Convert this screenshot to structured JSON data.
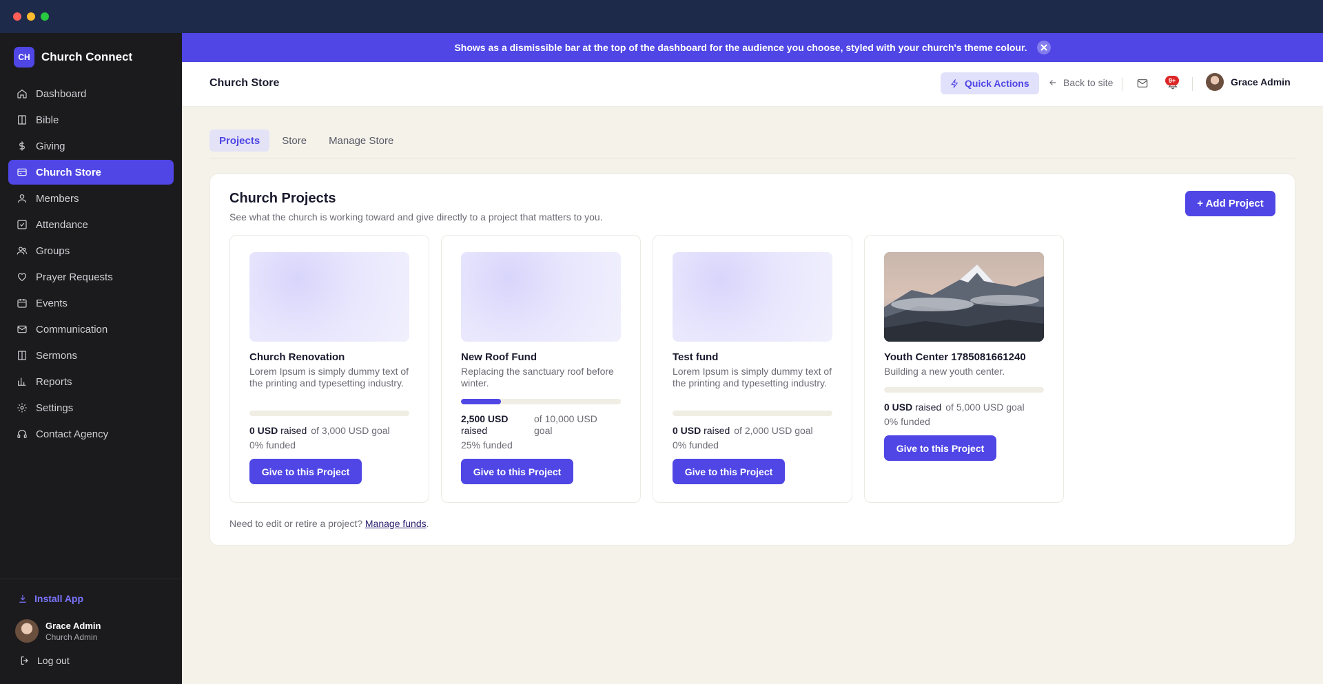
{
  "app": {
    "logo_text": "CH",
    "name": "Church Connect"
  },
  "sidebar": {
    "items": [
      {
        "label": "Dashboard",
        "icon": "home-icon",
        "active": false
      },
      {
        "label": "Bible",
        "icon": "book-icon",
        "active": false
      },
      {
        "label": "Giving",
        "icon": "dollar-icon",
        "active": false
      },
      {
        "label": "Church Store",
        "icon": "card-icon",
        "active": true
      },
      {
        "label": "Members",
        "icon": "user-icon",
        "active": false
      },
      {
        "label": "Attendance",
        "icon": "check-square-icon",
        "active": false
      },
      {
        "label": "Groups",
        "icon": "users-icon",
        "active": false
      },
      {
        "label": "Prayer Requests",
        "icon": "heart-icon",
        "active": false
      },
      {
        "label": "Events",
        "icon": "calendar-icon",
        "active": false
      },
      {
        "label": "Communication",
        "icon": "mail-icon",
        "active": false
      },
      {
        "label": "Sermons",
        "icon": "book-open-icon",
        "active": false
      },
      {
        "label": "Reports",
        "icon": "bar-chart-icon",
        "active": false
      },
      {
        "label": "Settings",
        "icon": "gear-icon",
        "active": false
      },
      {
        "label": "Contact Agency",
        "icon": "headphones-icon",
        "active": false
      }
    ],
    "install_label": "Install App",
    "user": {
      "name": "Grace Admin",
      "role": "Church Admin"
    },
    "logout_label": "Log out"
  },
  "announcement": {
    "text": "Shows as a dismissible bar at the top of the dashboard for the audience you choose, styled with your church's theme colour."
  },
  "topbar": {
    "title": "Church Store",
    "quick_actions": "Quick Actions",
    "back_to_site": "Back to site",
    "notification_badge": "9+",
    "user_name": "Grace Admin"
  },
  "tabs": [
    {
      "label": "Projects",
      "active": true
    },
    {
      "label": "Store",
      "active": false
    },
    {
      "label": "Manage Store",
      "active": false
    }
  ],
  "projects_panel": {
    "title": "Church Projects",
    "subtitle": "See what the church is working toward and give directly to a project that matters to you.",
    "add_button": "+ Add Project",
    "give_label": "Give to this Project",
    "footer_text": "Need to edit or retire a project?",
    "footer_link": "Manage funds",
    "footer_end": "."
  },
  "projects": [
    {
      "title": "Church Renovation",
      "description": "Lorem Ipsum is simply dummy text of the printing and typesetting industry.",
      "raised": "0 USD",
      "raised_label": "raised",
      "goal": "of 3,000 USD goal",
      "funded": "0% funded",
      "progress": 0,
      "image": "placeholder"
    },
    {
      "title": "New Roof Fund",
      "description": "Replacing the sanctuary roof before winter.",
      "raised": "2,500 USD",
      "raised_label": "raised",
      "goal": "of 10,000 USD goal",
      "funded": "25% funded",
      "progress": 0.25,
      "image": "placeholder"
    },
    {
      "title": "Test fund",
      "description": "Lorem Ipsum is simply dummy text of the printing and typesetting industry.",
      "raised": "0 USD",
      "raised_label": "raised",
      "goal": "of 2,000 USD goal",
      "funded": "0% funded",
      "progress": 0,
      "image": "placeholder"
    },
    {
      "title": "Youth Center 1785081661240",
      "description": "Building a new youth center.",
      "raised": "0 USD",
      "raised_label": "raised",
      "goal": "of 5,000 USD goal",
      "funded": "0% funded",
      "progress": 0,
      "image": "mountain-photo"
    }
  ],
  "colors": {
    "accent": "#4f46e5",
    "sidebar_bg": "#1b1b1d",
    "page_bg": "#f4f2e9",
    "badge": "#dc2626"
  }
}
